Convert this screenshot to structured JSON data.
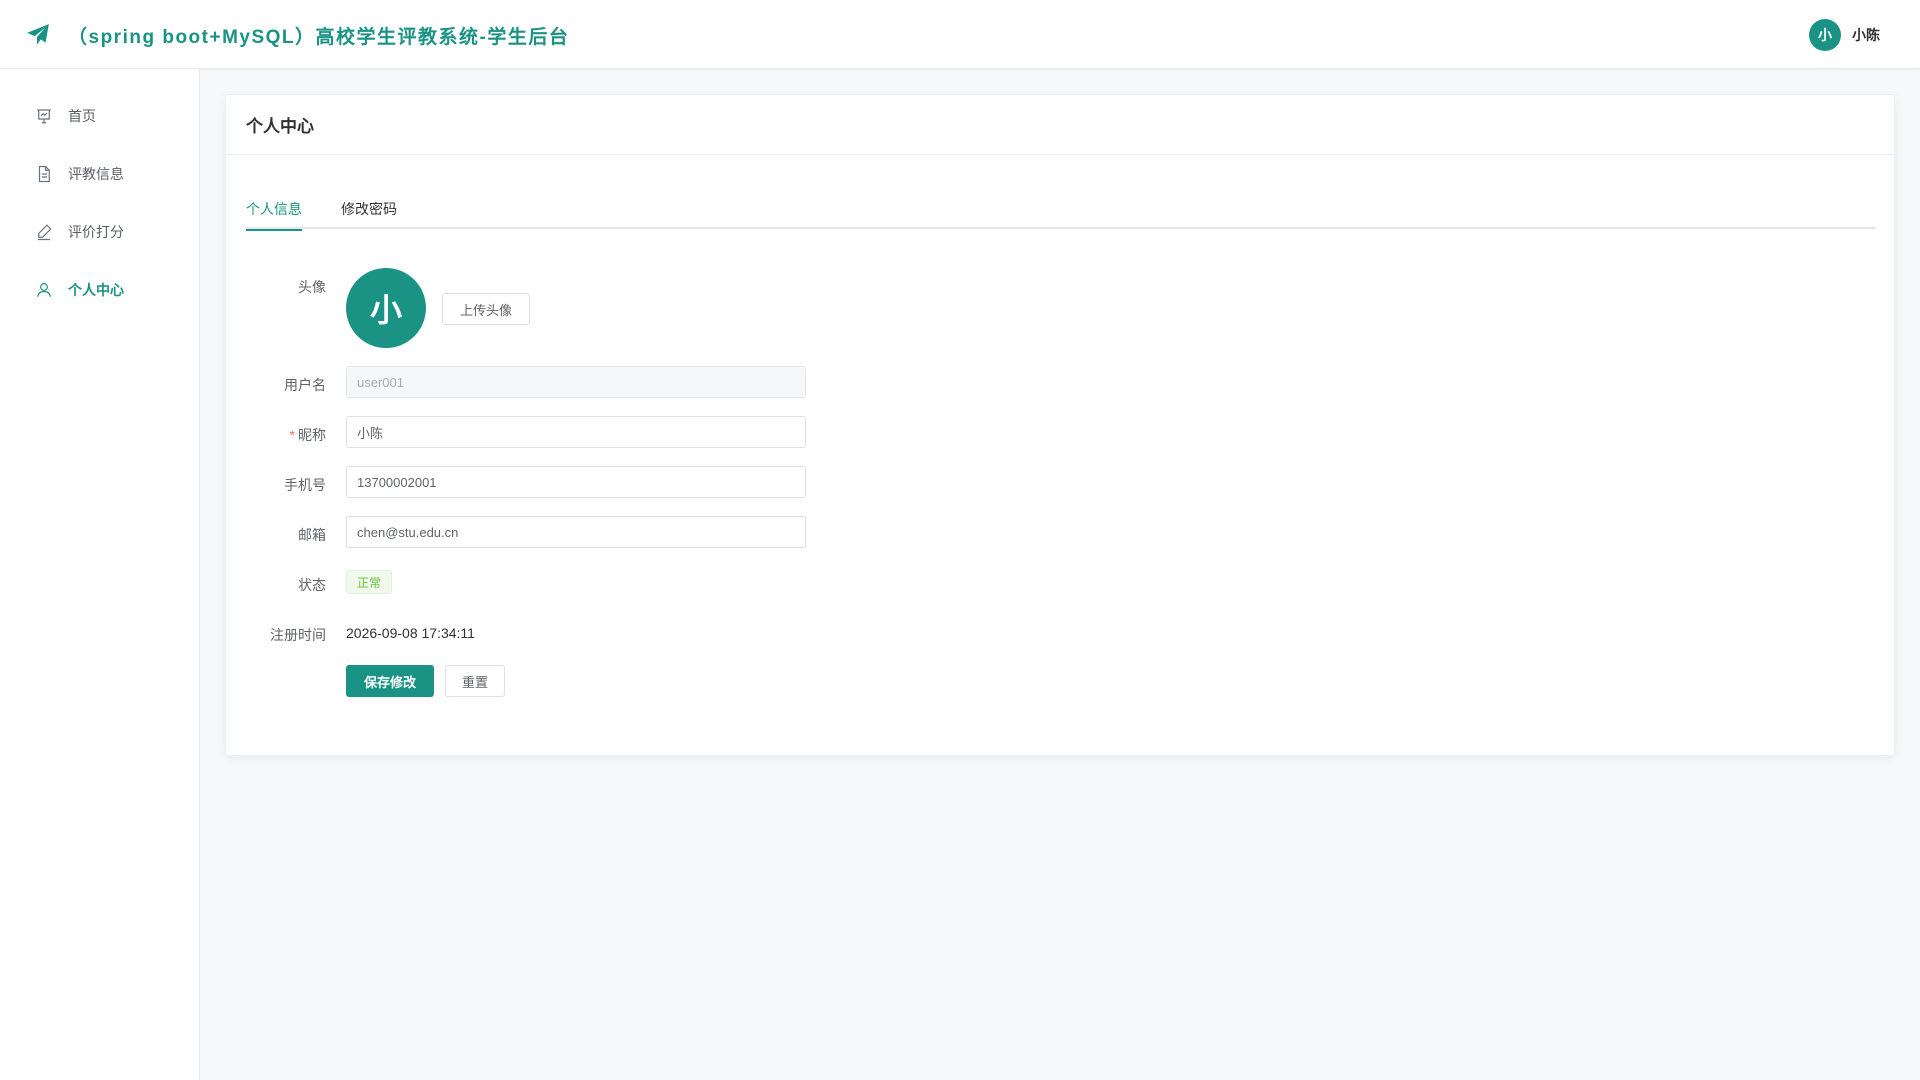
{
  "header": {
    "title": "（spring boot+MySQL）高校学生评教系统-学生后台",
    "logo_icon": "paper-plane-icon",
    "user_avatar_text": "小",
    "user_name": "小陈"
  },
  "sidebar": {
    "items": [
      {
        "label": "首页",
        "icon": "dashboard-icon",
        "active": false
      },
      {
        "label": "评教信息",
        "icon": "document-icon",
        "active": false
      },
      {
        "label": "评价打分",
        "icon": "edit-pen-icon",
        "active": false
      },
      {
        "label": "个人中心",
        "icon": "user-icon",
        "active": true
      }
    ]
  },
  "card": {
    "title": "个人中心",
    "tabs": [
      {
        "label": "个人信息",
        "active": true
      },
      {
        "label": "修改密码",
        "active": false
      }
    ]
  },
  "form": {
    "avatar_label": "头像",
    "avatar_text": "小",
    "upload_button": "上传头像",
    "username_label": "用户名",
    "username_value": "user001",
    "nickname_label": "昵称",
    "nickname_required": "*",
    "nickname_value": "小陈",
    "phone_label": "手机号",
    "phone_value": "13700002001",
    "email_label": "邮箱",
    "email_value": "chen@stu.edu.cn",
    "status_label": "状态",
    "status_value": "正常",
    "register_label": "注册时间",
    "register_value": "2026-09-08 17:34:11",
    "save_button": "保存修改",
    "reset_button": "重置"
  },
  "colors": {
    "accent": "#1a9384",
    "success": "#67c23a",
    "danger": "#f56c6c",
    "background": "#f6f8fa"
  }
}
